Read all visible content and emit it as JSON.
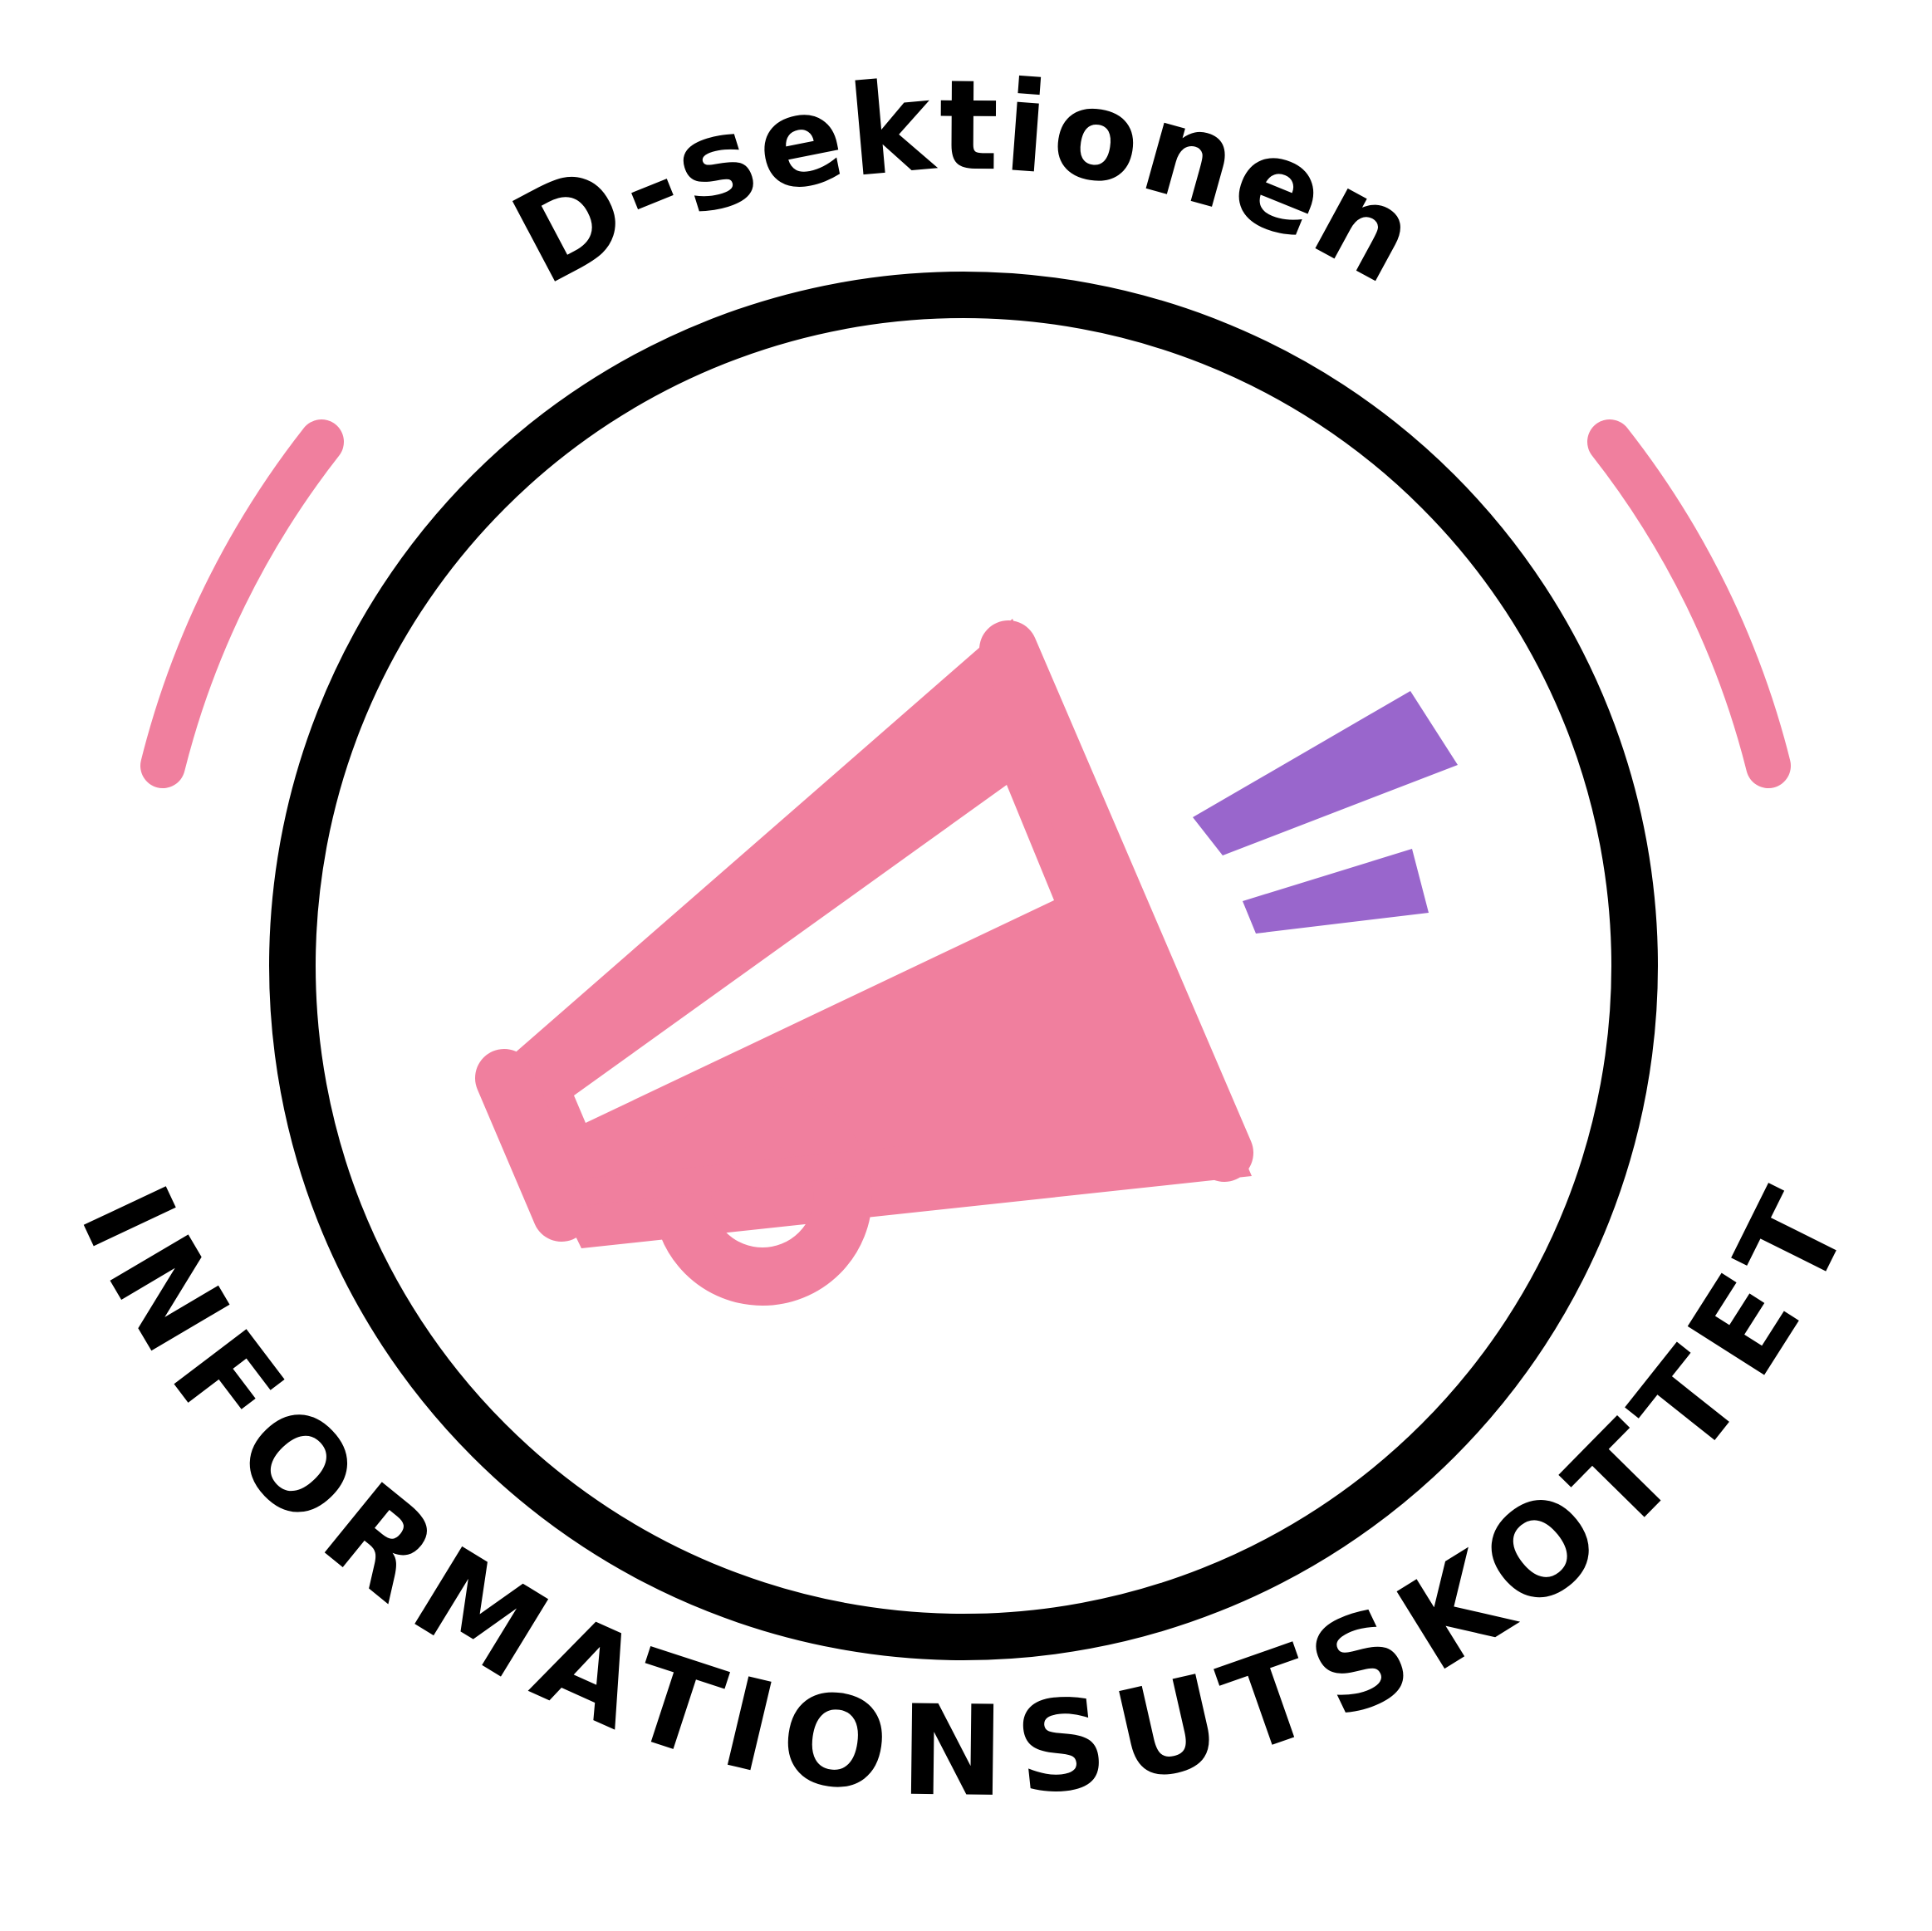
{
  "logo": {
    "top_text": "D-sektionen",
    "bottom_text": "INFORMATIONSUTSKOTTET",
    "icon": "megaphone-icon"
  },
  "colors": {
    "ring": "#000000",
    "text": "#000000",
    "arc_accent": "#f07f9e",
    "megaphone": "#f07f9e",
    "sound_lines": "#9966cc",
    "background": "#ffffff"
  }
}
